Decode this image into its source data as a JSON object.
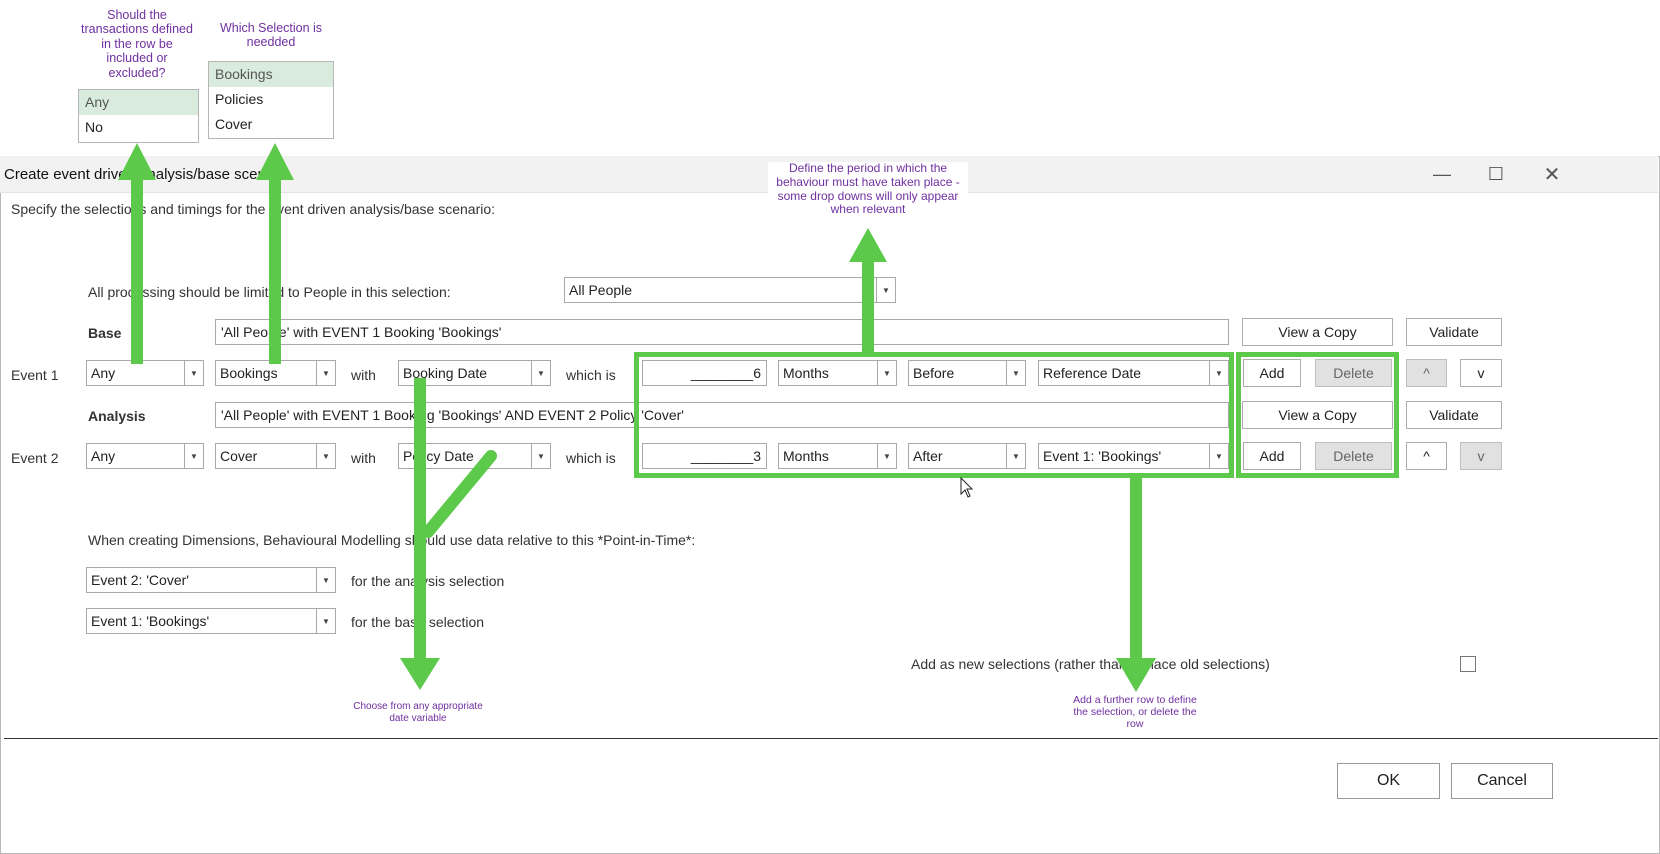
{
  "window": {
    "title": "Create event driven analysis/base scenario",
    "instruction": "Specify the selections and timings for the event driven analysis/base scenario:"
  },
  "limit": {
    "label": "All processing should be limited to People in this selection:",
    "value": "All People"
  },
  "base": {
    "label": "Base",
    "text": "'All People' with EVENT 1 Booking 'Bookings'",
    "view_copy": "View a Copy",
    "validate": "Validate"
  },
  "analysis": {
    "label": "Analysis",
    "text": "'All People' with EVENT 1 Booking 'Bookings' AND EVENT 2 Policy 'Cover'",
    "view_copy": "View a Copy",
    "validate": "Validate"
  },
  "events": [
    {
      "label": "Event 1",
      "include": "Any",
      "selection": "Bookings",
      "with": "with",
      "date_var": "Booking Date",
      "which_is": "which is",
      "amount": "________6",
      "unit": "Months",
      "direction": "Before",
      "reference": "Reference Date",
      "add": "Add",
      "delete": "Delete",
      "up": "^",
      "down": "v"
    },
    {
      "label": "Event 2",
      "include": "Any",
      "selection": "Cover",
      "with": "with",
      "date_var": "Policy Date",
      "which_is": "which is",
      "amount": "________3",
      "unit": "Months",
      "direction": "After",
      "reference": "Event 1: 'Bookings'",
      "add": "Add",
      "delete": "Delete",
      "up": "^",
      "down": "v"
    }
  ],
  "pit": {
    "label": "When creating Dimensions, Behavioural Modelling should use data relative to this *Point-in-Time*:",
    "analysis_value": "Event 2: 'Cover'",
    "analysis_label": "for the analysis selection",
    "base_value": "Event 1: 'Bookings'",
    "base_label": "for the base selection"
  },
  "add_new": {
    "label": "Add as new selections (rather than replace old selections)"
  },
  "footer": {
    "ok": "OK",
    "cancel": "Cancel"
  },
  "popups": {
    "include_options": [
      "Any",
      "No"
    ],
    "selection_options": [
      "Bookings",
      "Policies",
      "Cover"
    ]
  },
  "annotations": {
    "include": "Should the transactions defined in the row be included or excluded?",
    "selection": "Which Selection is needded",
    "period": "Define the period in which the behaviour must have taken place - some drop downs will only appear when relevant",
    "date_var": "Choose from any appropriate date variable",
    "add_delete": "Add a further row to define the selection, or delete the row"
  },
  "colors": {
    "annotation_text": "#7030a0",
    "highlight_green": "#5cc94a",
    "popup_selected": "#d8ebdd"
  }
}
